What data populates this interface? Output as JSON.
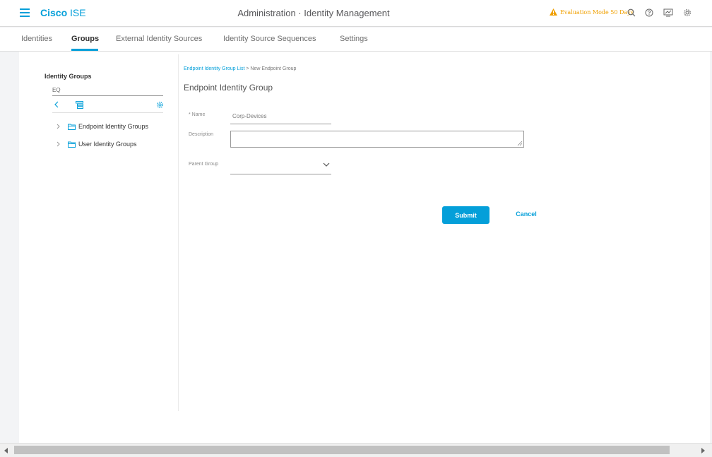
{
  "header": {
    "brand_primary": "Cisco",
    "brand_secondary": "ISE",
    "title": "Administration · Identity Management",
    "eval_notice": "Evaluation Mode 50 Days",
    "icons": [
      "menu-icon",
      "warning-icon",
      "search-icon",
      "help-icon",
      "notifications-icon",
      "gear-icon"
    ]
  },
  "nav": {
    "tabs": [
      {
        "label": "Identities"
      },
      {
        "label": "Groups"
      },
      {
        "label": "External Identity Sources"
      },
      {
        "label": "Identity Source Sequences"
      },
      {
        "label": "Settings"
      }
    ],
    "active": "Groups"
  },
  "sidebar": {
    "title": "Identity Groups",
    "search_value": "EQ",
    "tree": [
      {
        "label": "Endpoint Identity Groups"
      },
      {
        "label": "User Identity Groups"
      }
    ]
  },
  "form": {
    "breadcrumb_link": "Endpoint Identity Group List",
    "breadcrumb_sep": ">",
    "breadcrumb_current": "New Endpoint Group",
    "title": "Endpoint Identity Group",
    "name_label": "* Name",
    "name_value": "Corp-Devices",
    "description_label": "Description",
    "description_value": "",
    "parent_label": "Parent Group",
    "parent_value": "",
    "submit_label": "Submit",
    "cancel_label": "Cancel"
  },
  "colors": {
    "accent": "#049fd9",
    "warning": "#f0a000"
  }
}
